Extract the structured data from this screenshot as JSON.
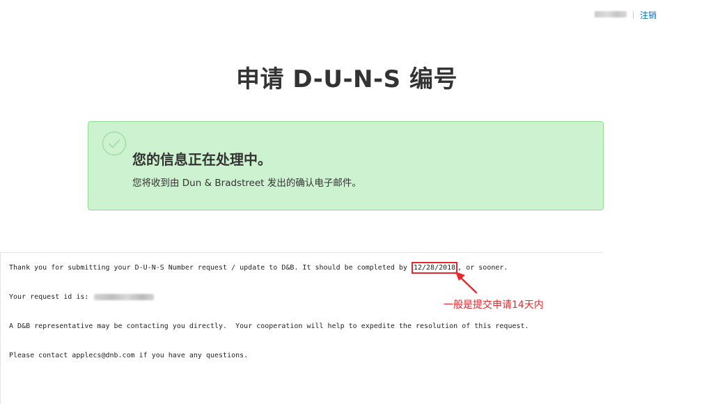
{
  "header": {
    "user_name_redacted": "",
    "divider": "|",
    "logout_label": "注销"
  },
  "page": {
    "title": "申请 D-U-N-S 编号"
  },
  "notice": {
    "heading": "您的信息正在处理中。",
    "subtext": "您将收到由 Dun & Bradstreet 发出的确认电子邮件。",
    "icon": "check-circle-icon",
    "background_color": "#cdf2d0",
    "border_color": "#8fdb92"
  },
  "email": {
    "line1_before": "Thank you for submitting your D-U-N-S Number request / update to D&B. It should be completed by ",
    "completion_date": "12/28/2018",
    "line1_after": ", or sooner.",
    "line2_label": "Your request id is: ",
    "request_id_redacted": "",
    "line3": "A D&B representative may be contacting you directly.  Your cooperation will help to expedite the resolution of this request.",
    "line4": "Please contact applecs@dnb.com if you have any questions."
  },
  "annotation": {
    "label": "一般是提交申请14天内",
    "color": "#e8262b",
    "icon": "arrow-icon"
  }
}
